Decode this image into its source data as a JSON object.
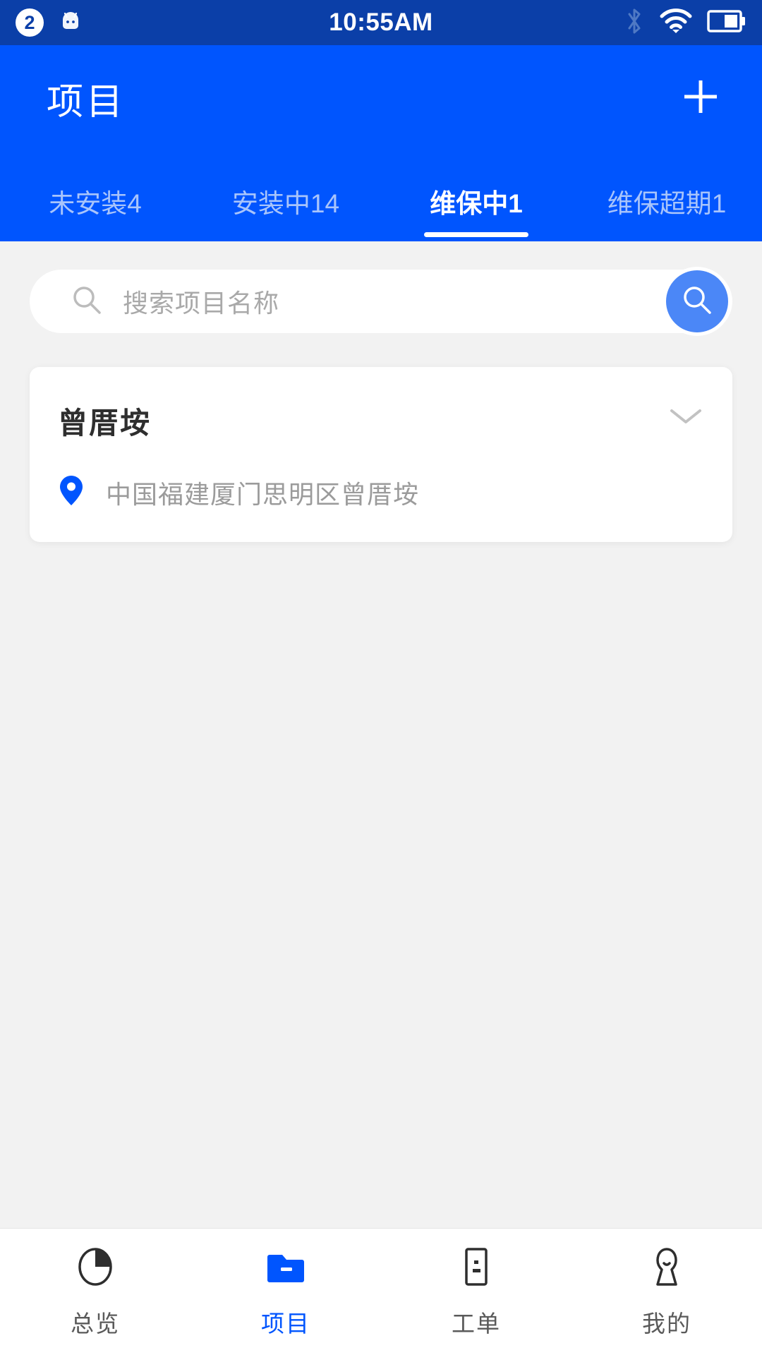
{
  "statusbar": {
    "notification_count": "2",
    "robot_icon": "android-robot-icon",
    "time": "10:55AM",
    "icons": [
      "bluetooth-icon",
      "wifi-icon",
      "battery-icon"
    ]
  },
  "header": {
    "title": "项目",
    "add_icon": "plus-icon",
    "tabs": [
      {
        "label": "未安装4",
        "active": false
      },
      {
        "label": "安装中14",
        "active": false
      },
      {
        "label": "维保中1",
        "active": true
      },
      {
        "label": "维保超期1",
        "active": false
      }
    ]
  },
  "search": {
    "placeholder": "搜索项目名称",
    "value": "",
    "icon": "search-icon",
    "button_icon": "search-icon"
  },
  "projects": [
    {
      "name": "曾厝垵",
      "address": "中国福建厦门思明区曾厝垵",
      "pin_icon": "location-pin-icon",
      "expand_icon": "chevron-down-icon"
    }
  ],
  "bottomnav": [
    {
      "label": "总览",
      "icon": "pie-chart-icon",
      "active": false
    },
    {
      "label": "项目",
      "icon": "folder-icon",
      "active": true
    },
    {
      "label": "工单",
      "icon": "document-icon",
      "active": false
    },
    {
      "label": "我的",
      "icon": "person-icon",
      "active": false
    }
  ],
  "colors": {
    "statusbar_bg": "#0b3fa8",
    "header_bg": "#0055fe",
    "accent": "#0055fe",
    "search_button": "#4b87f7",
    "page_bg": "#f2f2f2"
  }
}
